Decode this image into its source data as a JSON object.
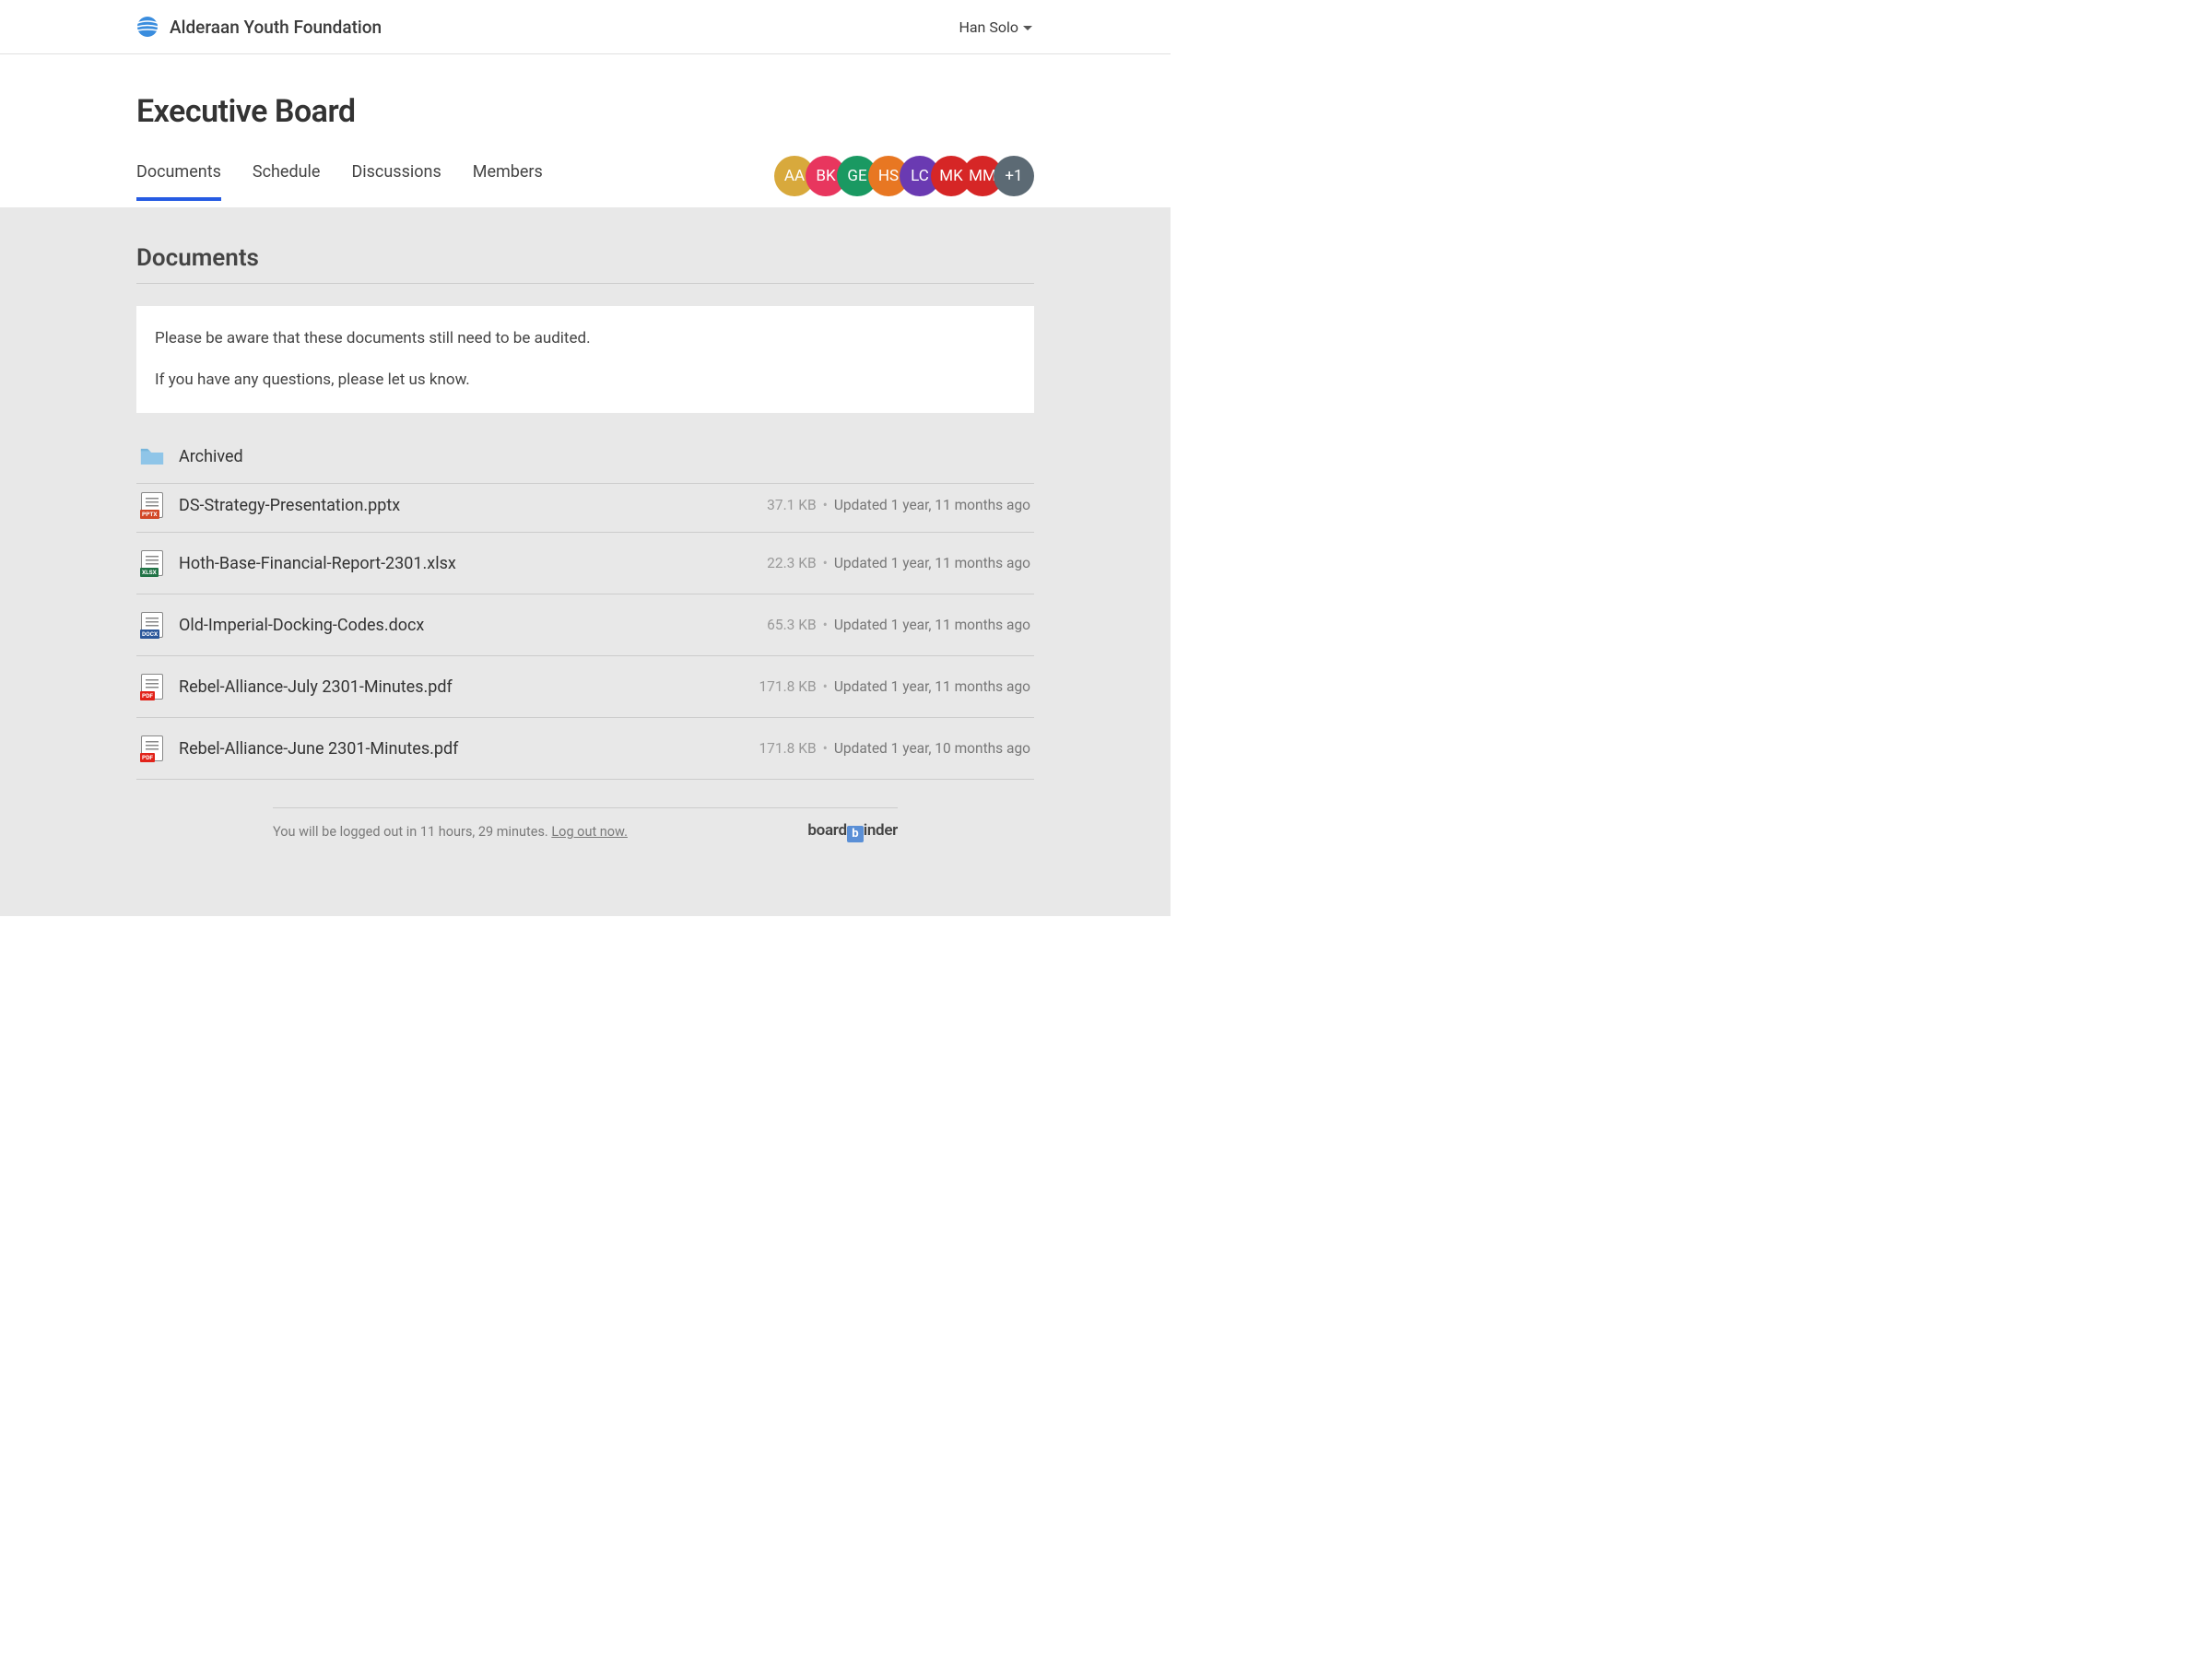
{
  "header": {
    "org_name": "Alderaan Youth Foundation",
    "user_name": "Han Solo"
  },
  "page": {
    "title": "Executive Board",
    "section_title": "Documents"
  },
  "tabs": [
    {
      "label": "Documents",
      "active": true
    },
    {
      "label": "Schedule",
      "active": false
    },
    {
      "label": "Discussions",
      "active": false
    },
    {
      "label": "Members",
      "active": false
    }
  ],
  "avatars": [
    {
      "initials": "AA",
      "color": "#d8a93c"
    },
    {
      "initials": "BK",
      "color": "#e8365e"
    },
    {
      "initials": "GE",
      "color": "#1a9962"
    },
    {
      "initials": "HS",
      "color": "#e87722"
    },
    {
      "initials": "LC",
      "color": "#6a3ab2"
    },
    {
      "initials": "MK",
      "color": "#d62626"
    },
    {
      "initials": "MM",
      "color": "#d62626"
    },
    {
      "initials": "+1",
      "color": "#5c6a74"
    }
  ],
  "notice": {
    "line1": "Please be aware that these documents still need to be audited.",
    "line2": "If you have any questions, please let us know."
  },
  "folder": {
    "name": "Archived"
  },
  "documents": [
    {
      "name": "DS-Strategy-Presentation.pptx",
      "size": "37.1 KB",
      "updated": "Updated 1 year, 11 months ago",
      "type": "pptx",
      "tag_color": "#d24726"
    },
    {
      "name": "Hoth-Base-Financial-Report-2301.xlsx",
      "size": "22.3 KB",
      "updated": "Updated 1 year, 11 months ago",
      "type": "xlsx",
      "tag_color": "#217346"
    },
    {
      "name": "Old-Imperial-Docking-Codes.docx",
      "size": "65.3 KB",
      "updated": "Updated 1 year, 11 months ago",
      "type": "docx",
      "tag_color": "#2b579a"
    },
    {
      "name": "Rebel-Alliance-July 2301-Minutes.pdf",
      "size": "171.8 KB",
      "updated": "Updated 1 year, 11 months ago",
      "type": "pdf",
      "tag_color": "#e2231a"
    },
    {
      "name": "Rebel-Alliance-June 2301-Minutes.pdf",
      "size": "171.8 KB",
      "updated": "Updated 1 year, 10 months ago",
      "type": "pdf",
      "tag_color": "#e2231a"
    }
  ],
  "footer": {
    "logout_text": "You will be logged out in 11 hours, 29 minutes. ",
    "logout_link": "Log out now.",
    "product_pre": "board",
    "product_b": "b",
    "product_post": "inder"
  }
}
